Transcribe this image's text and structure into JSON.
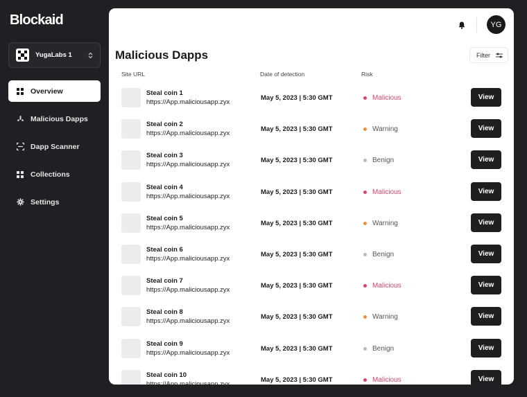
{
  "app": {
    "logo_text": "Blockaid"
  },
  "org": {
    "name": "YugaLabs 1"
  },
  "sidebar": {
    "items": [
      {
        "label": "Overview",
        "icon": "grid-icon",
        "active": true
      },
      {
        "label": "Malicious Dapps",
        "icon": "hazard-icon",
        "active": false
      },
      {
        "label": "Dapp Scanner",
        "icon": "scan-icon",
        "active": false
      },
      {
        "label": "Collections",
        "icon": "collections-icon",
        "active": false
      },
      {
        "label": "Settings",
        "icon": "gear-icon",
        "active": false
      }
    ]
  },
  "header": {
    "avatar_initials": "YG"
  },
  "main": {
    "title": "Malicious Dapps",
    "filter_label": "Filter",
    "columns": [
      "Site URL",
      "Date of detection",
      "Risk"
    ],
    "view_label": "View",
    "rows": [
      {
        "name": "Steal coin 1",
        "url": "https://App.maliciousapp.zyx",
        "date": "May 5, 2023 | 5:30 GMT",
        "risk": "Malicious"
      },
      {
        "name": "Steal coin 2",
        "url": "https://App.maliciousapp.zyx",
        "date": "May 5, 2023 | 5:30 GMT",
        "risk": "Warning"
      },
      {
        "name": "Steal coin 3",
        "url": "https://App.maliciousapp.zyx",
        "date": "May 5, 2023 | 5:30 GMT",
        "risk": "Benign"
      },
      {
        "name": "Steal coin 4",
        "url": "https://App.maliciousapp.zyx",
        "date": "May 5, 2023 | 5:30 GMT",
        "risk": "Malicious"
      },
      {
        "name": "Steal coin 5",
        "url": "https://App.maliciousapp.zyx",
        "date": "May 5, 2023 | 5:30 GMT",
        "risk": "Warning"
      },
      {
        "name": "Steal coin 6",
        "url": "https://App.maliciousapp.zyx",
        "date": "May 5, 2023 | 5:30 GMT",
        "risk": "Benign"
      },
      {
        "name": "Steal coin 7",
        "url": "https://App.maliciousapp.zyx",
        "date": "May 5, 2023 | 5:30 GMT",
        "risk": "Malicious"
      },
      {
        "name": "Steal coin 8",
        "url": "https://App.maliciousapp.zyx",
        "date": "May 5, 2023 | 5:30 GMT",
        "risk": "Warning"
      },
      {
        "name": "Steal coin 9",
        "url": "https://App.maliciousapp.zyx",
        "date": "May 5, 2023 | 5:30 GMT",
        "risk": "Benign"
      },
      {
        "name": "Steal coin 10",
        "url": "https://App.maliciousapp.zyx",
        "date": "May 5, 2023 | 5:30 GMT",
        "risk": "Malicious"
      }
    ]
  },
  "colors": {
    "Malicious": "#d6456e",
    "Warning": "#e8923a",
    "Benign": "#b9b9bd",
    "risk_text_Malicious": "#d6456e",
    "risk_text_Warning": "#555558",
    "risk_text_Benign": "#555558"
  }
}
